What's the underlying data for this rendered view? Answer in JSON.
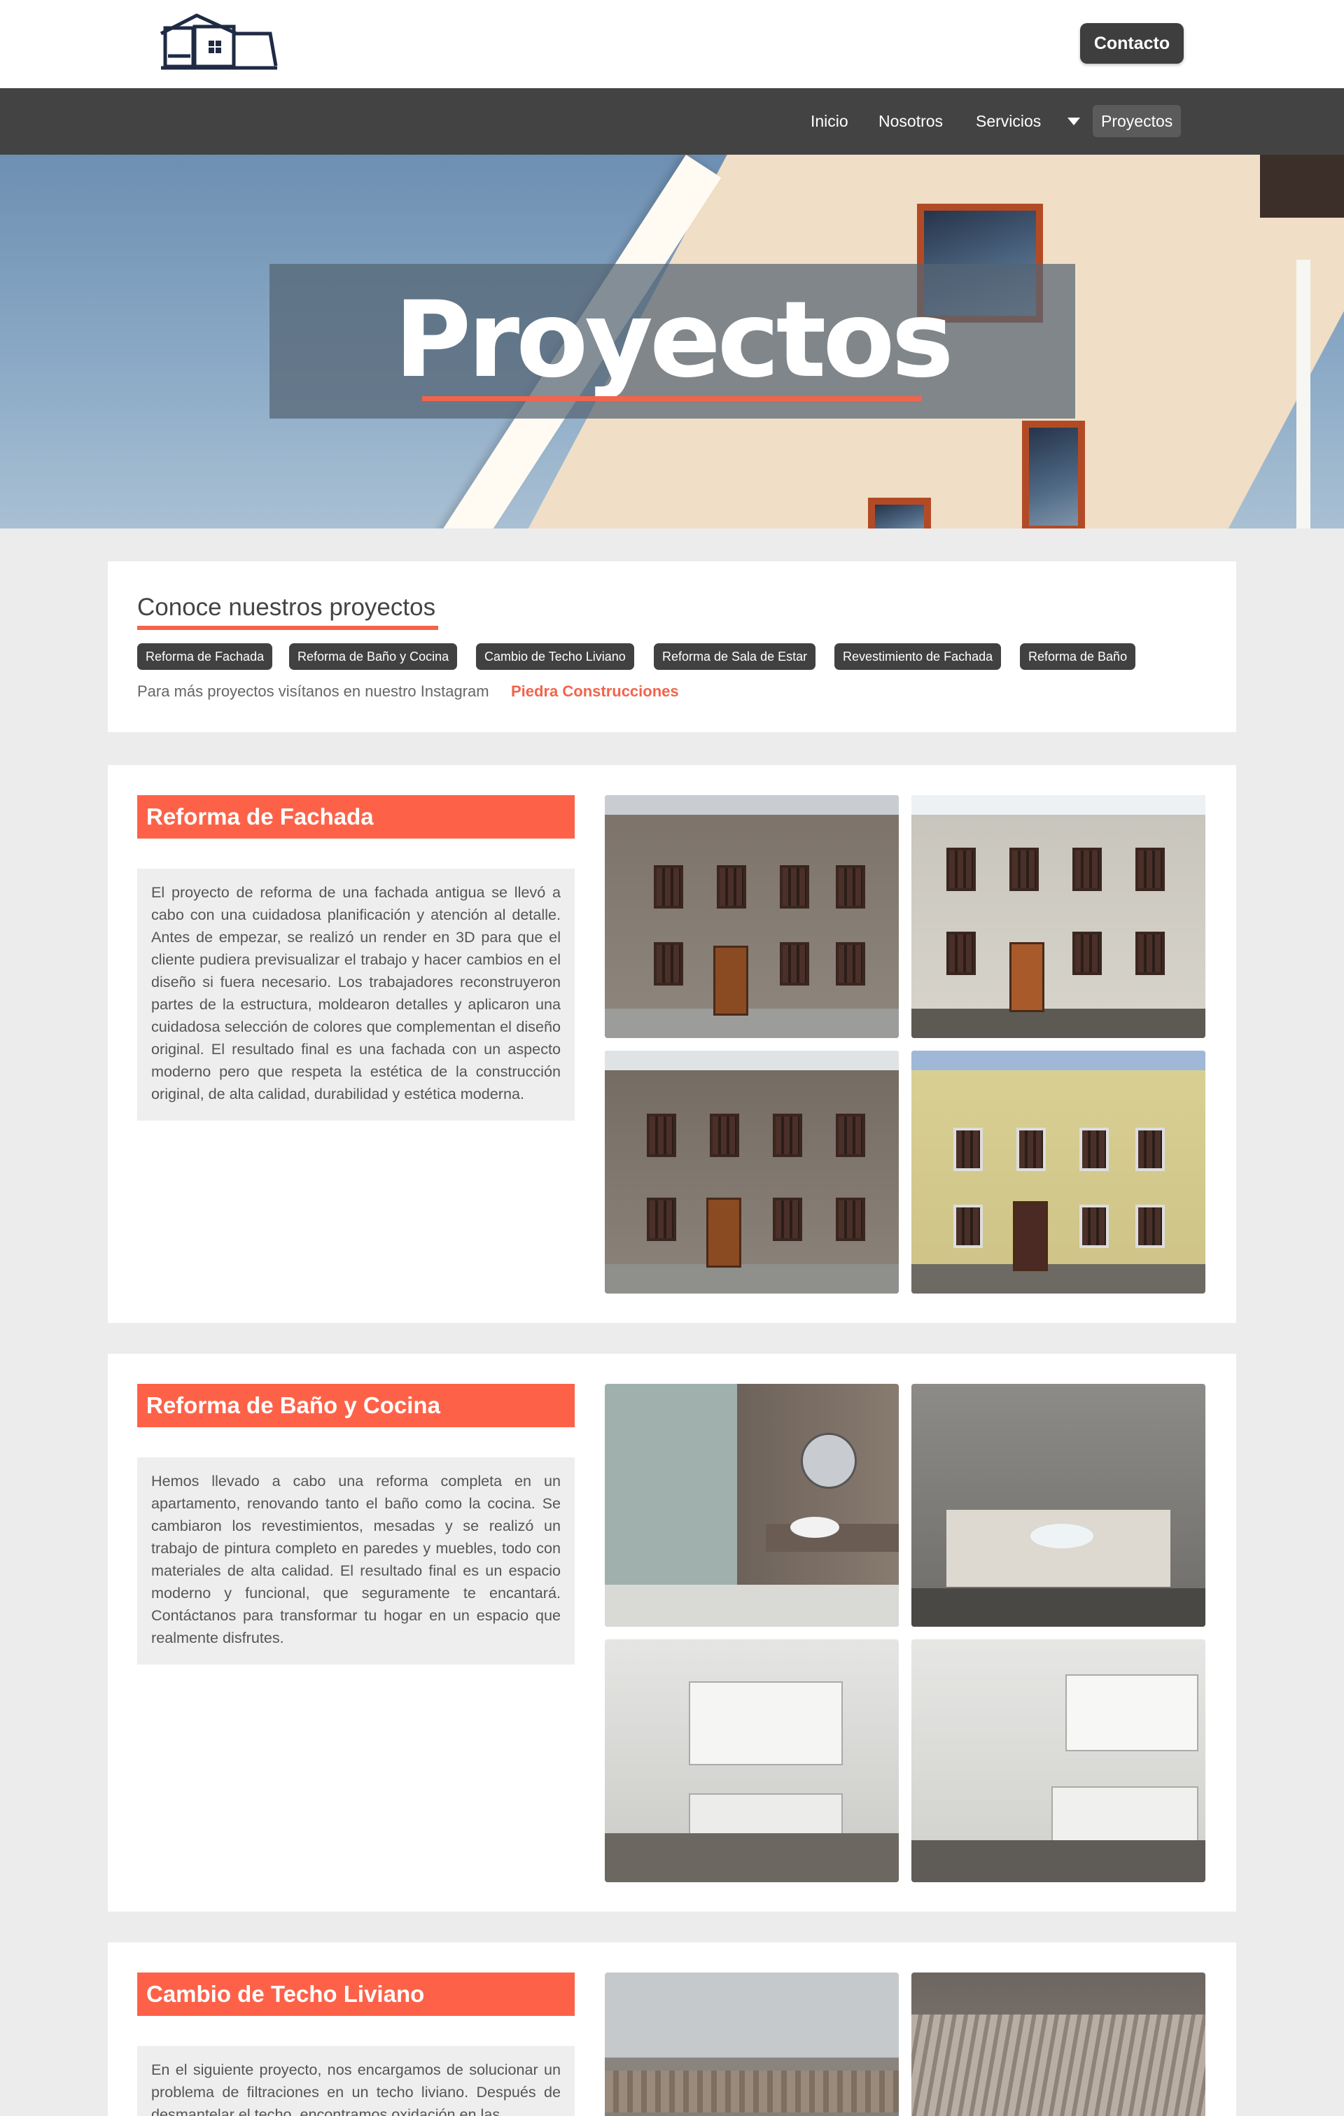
{
  "header": {
    "contact_label": "Contacto",
    "logo_icon": "house-logo-icon"
  },
  "nav": {
    "items": [
      {
        "label": "Inicio"
      },
      {
        "label": "Nosotros"
      },
      {
        "label": "Servicios"
      },
      {
        "label": "Proyectos"
      }
    ],
    "dropdown_icon": "caret-down-icon"
  },
  "hero": {
    "title": "Proyectos"
  },
  "intro": {
    "title": "Conoce nuestros proyectos",
    "tags": [
      "Reforma de Fachada",
      "Reforma de Baño y Cocina",
      "Cambio de Techo Liviano",
      "Reforma de Sala de Estar",
      "Revestimiento de Fachada",
      "Reforma de Baño"
    ],
    "instagram_text": "Para más proyectos visítanos en nuestro Instagram",
    "instagram_link": "Piedra Construcciones"
  },
  "projects": [
    {
      "title": "Reforma de Fachada",
      "description": "El proyecto de reforma de una fachada antigua se llevó a cabo con una cuidadosa planificación y atención al detalle. Antes de empezar, se realizó un render en 3D para que el cliente pudiera previsualizar el trabajo y hacer cambios en el diseño si fuera necesario. Los trabajadores reconstruyeron partes de la estructura, moldearon detalles y aplicaron una cuidadosa selección de colores que complementan el diseño original. El resultado final es una fachada con un aspecto moderno pero que respeta la estética de la construcción original, de alta calidad, durabilidad y estética moderna."
    },
    {
      "title": "Reforma de Baño y Cocina",
      "description": "Hemos llevado a cabo una reforma completa en un apartamento, renovando tanto el baño como la cocina. Se cambiaron los revestimientos, mesadas y se realizó un trabajo de pintura completo en paredes y muebles, todo con materiales de alta calidad. El resultado final es un espacio moderno y funcional, que seguramente te encantará. Contáctanos para transformar tu hogar en un espacio que realmente disfrutes."
    },
    {
      "title": "Cambio de Techo Liviano",
      "description": "En el siguiente proyecto, nos encargamos de solucionar un problema de filtraciones en un techo liviano. Después de desmantelar el techo, encontramos oxidación en las"
    }
  ],
  "colors": {
    "accent": "#fd6248",
    "nav_bg": "#434343",
    "page_bg": "#ececec"
  }
}
